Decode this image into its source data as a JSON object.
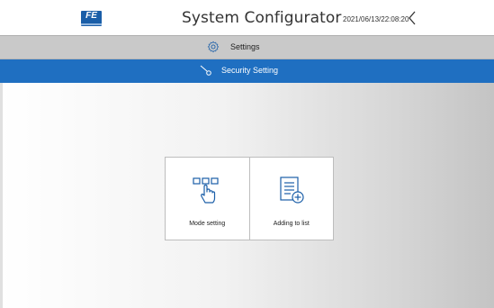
{
  "header": {
    "logo_text": "FE",
    "title": "System Configurator",
    "datetime": "2021/06/13/22:08:20",
    "back_icon": "chevron-left-icon"
  },
  "settings_bar": {
    "label": "Settings",
    "icon": "gear-icon"
  },
  "security_bar": {
    "label": "Security Setting",
    "icon": "key-icon"
  },
  "tiles": [
    {
      "label": "Mode setting",
      "icon": "hand-pointer-keys-icon"
    },
    {
      "label": "Adding to list",
      "icon": "list-add-icon"
    }
  ],
  "colors": {
    "accent": "#1f6fc1",
    "settings_bar": "#c9c9c9",
    "icon_blue": "#1a5ea8"
  }
}
